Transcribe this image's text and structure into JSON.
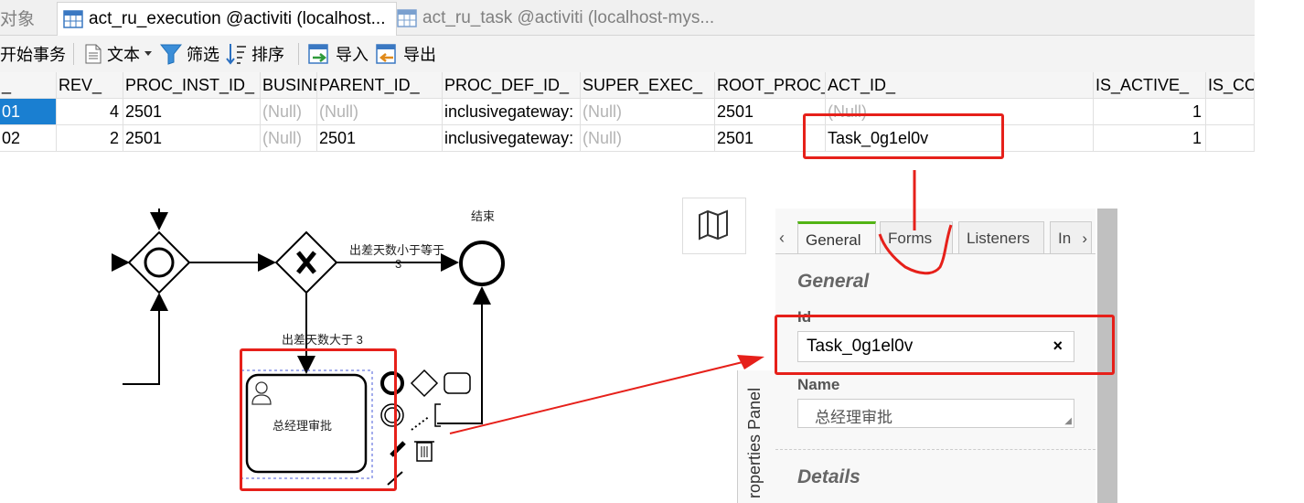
{
  "tabs": [
    {
      "label": "对象"
    },
    {
      "label": "act_ru_execution @activiti (localhost..."
    },
    {
      "label": "act_ru_task @activiti (localhost-mys..."
    }
  ],
  "toolbar": {
    "begin_tx": "开始事务",
    "text": "文本",
    "filter": "筛选",
    "sort": "排序",
    "import": "导入",
    "export": "导出"
  },
  "grid": {
    "columns": [
      "_",
      "REV_",
      "PROC_INST_ID_",
      "BUSINE",
      "PARENT_ID_",
      "PROC_DEF_ID_",
      "SUPER_EXEC_",
      "ROOT_PROC_",
      "ACT_ID_",
      "IS_ACTIVE_",
      "IS_CO"
    ],
    "rows": [
      {
        "id": "01",
        "rev": "4",
        "proc_inst": "2501",
        "business": "(Null)",
        "parent": "(Null)",
        "proc_def": "inclusivegateway:",
        "super_exec": "(Null)",
        "root_proc": "2501",
        "act_id": "(Null)",
        "is_active": "1"
      },
      {
        "id": "02",
        "rev": "2",
        "proc_inst": "2501",
        "business": "(Null)",
        "parent": "2501",
        "proc_def": "inclusivegateway:",
        "super_exec": "(Null)",
        "root_proc": "2501",
        "act_id": "Task_0g1el0v",
        "is_active": "1"
      }
    ]
  },
  "diagram": {
    "end_label": "结束",
    "flow_le3": "出差天数小于等于",
    "flow_le3_num": "3",
    "flow_gt3": "出差天数大于 3",
    "task_label": "总经理审批"
  },
  "properties": {
    "tabs": [
      "General",
      "Forms",
      "Listeners",
      "In"
    ],
    "section_general": "General",
    "id_label": "Id",
    "id_value": "Task_0g1el0v",
    "clear_symbol": "×",
    "name_label": "Name",
    "name_value": "总经理审批",
    "section_details": "Details",
    "sidebar_label": "roperties Panel",
    "tab_prev": "‹",
    "tab_next": "›"
  },
  "colors": {
    "accent_green": "#52b415",
    "selection_blue": "#1a7fd1",
    "annotation_red": "#e6201a"
  }
}
